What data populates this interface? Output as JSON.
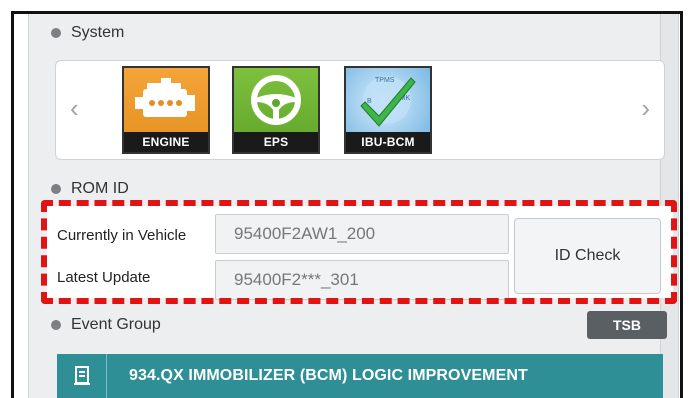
{
  "system": {
    "heading": "System",
    "modules": [
      {
        "label": "ENGINE",
        "icon": "engine-icon",
        "color": "#f09a2c"
      },
      {
        "label": "EPS",
        "icon": "steering-wheel-icon",
        "color": "#6db334"
      },
      {
        "label": "IBU-BCM",
        "icon": "checkmark-icon",
        "color": "#8cc4ee",
        "badges": [
          "TPMS",
          "B",
          "SMK"
        ]
      }
    ]
  },
  "rom_id": {
    "heading": "ROM ID",
    "current_label": "Currently in Vehicle",
    "current_value": "95400F2AW1_200",
    "latest_label": "Latest Update",
    "latest_value": "95400F2***_301",
    "check_button": "ID Check"
  },
  "event_group": {
    "heading": "Event Group",
    "tsb_button": "TSB",
    "items": [
      {
        "title": "934.QX IMMOBILIZER (BCM) LOGIC IMPROVEMENT",
        "icon": "document-icon"
      }
    ]
  },
  "colors": {
    "highlight": "#e01414",
    "event_bar": "#2e8f97"
  }
}
